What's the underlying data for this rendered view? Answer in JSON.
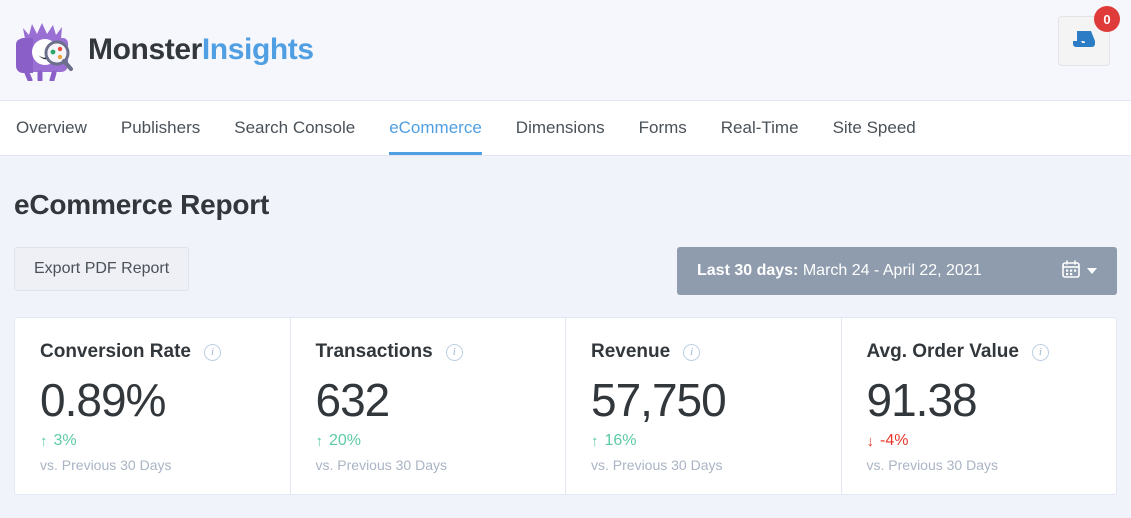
{
  "header": {
    "brand_primary": "Monster",
    "brand_secondary": "Insights",
    "logo_icon": "monster-mascot-magnifier-logo",
    "inbox_icon": "inbox-tray-icon",
    "notification_count": "0"
  },
  "nav": {
    "items": [
      {
        "label": "Overview",
        "active": false
      },
      {
        "label": "Publishers",
        "active": false
      },
      {
        "label": "Search Console",
        "active": false
      },
      {
        "label": "eCommerce",
        "active": true
      },
      {
        "label": "Dimensions",
        "active": false
      },
      {
        "label": "Forms",
        "active": false
      },
      {
        "label": "Real-Time",
        "active": false
      },
      {
        "label": "Site Speed",
        "active": false
      }
    ]
  },
  "main": {
    "page_title": "eCommerce Report",
    "export_button": "Export PDF Report",
    "daterange": {
      "label": "Last 30 days:",
      "value": "March 24 - April 22, 2021",
      "calendar_icon": "calendar-icon",
      "caret_icon": "chevron-down-icon"
    },
    "cards": [
      {
        "title": "Conversion Rate",
        "value": "0.89%",
        "delta": "3%",
        "direction": "up",
        "arrow": "↑",
        "compare": "vs. Previous 30 Days",
        "info_icon": "info-icon"
      },
      {
        "title": "Transactions",
        "value": "632",
        "delta": "20%",
        "direction": "up",
        "arrow": "↑",
        "compare": "vs. Previous 30 Days",
        "info_icon": "info-icon"
      },
      {
        "title": "Revenue",
        "value": "57,750",
        "delta": "16%",
        "direction": "up",
        "arrow": "↑",
        "compare": "vs. Previous 30 Days",
        "info_icon": "info-icon"
      },
      {
        "title": "Avg. Order Value",
        "value": "91.38",
        "delta": "-4%",
        "direction": "down",
        "arrow": "↓",
        "compare": "vs. Previous 30 Days",
        "info_icon": "info-icon"
      }
    ]
  },
  "colors": {
    "accent_blue": "#509fe2",
    "positive_green": "#5cc9a7",
    "negative_red": "#e8362a",
    "daterange_gray": "#8e9cad",
    "badge_red": "#df3b3b",
    "page_bg": "#f1f3fa"
  }
}
